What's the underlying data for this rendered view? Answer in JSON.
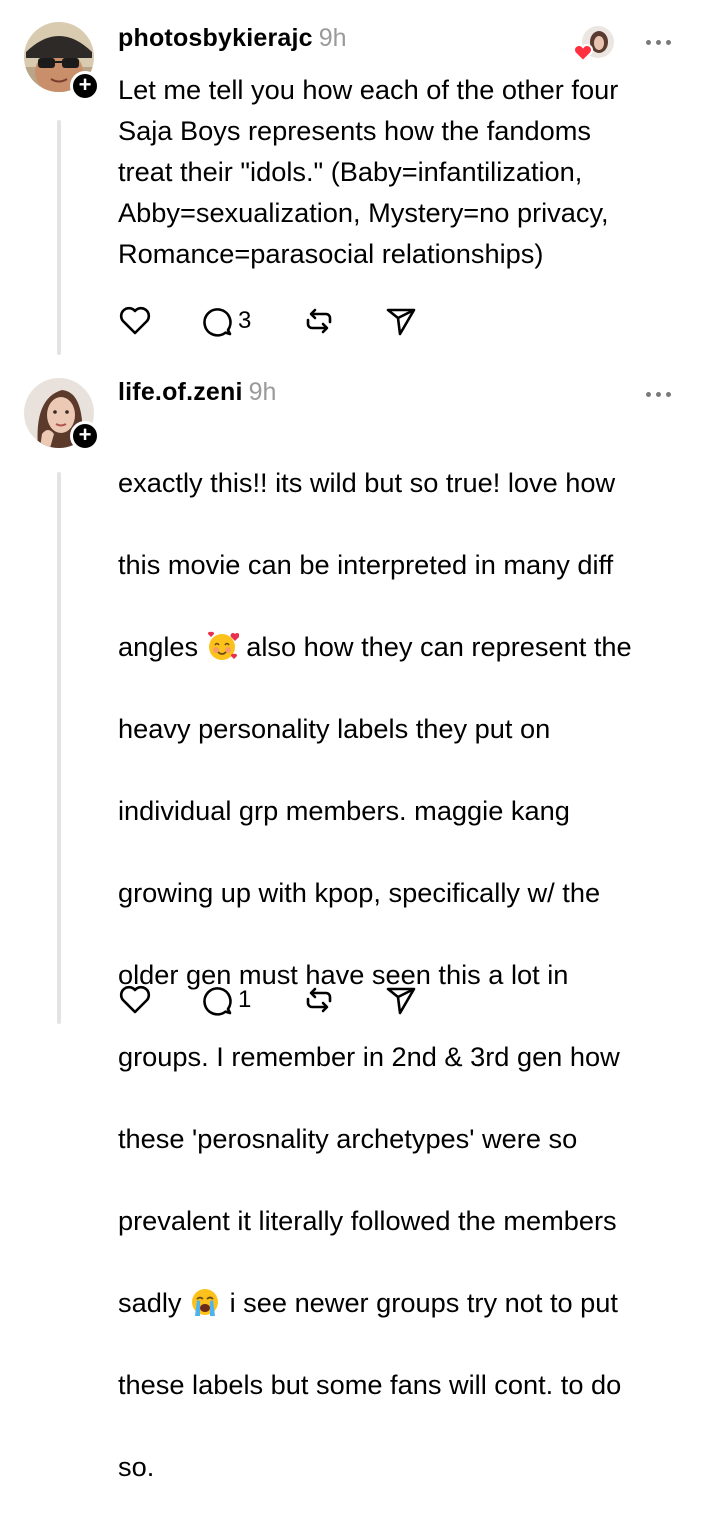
{
  "posts": [
    {
      "username": "photosbykierajc",
      "time": "9h",
      "text": "Let me tell you how each of the other four\nSaja Boys represents how the fandoms\ntreat their \"idols.\" (Baby=infantilization,\nAbby=sexualization, Mystery=no privacy,\nRomance=parasocial relationships)",
      "reply_count": "3"
    },
    {
      "username": "life.of.zeni",
      "time": "9h",
      "text_lines": {
        "l1": "exactly this!! its wild but so true! love how",
        "l2": "this movie can be interpreted in many diff",
        "l3a": "angles",
        "l3b": " also how they can represent the",
        "l4": "heavy personality labels they put on",
        "l5": "individual grp members. maggie kang",
        "l6": "growing up with kpop, specifically w/ the",
        "l7": "older gen must have seen this a lot in",
        "l8": "groups. I remember in 2nd & 3rd gen how",
        "l9": "these 'perosnality archetypes' were so",
        "l10": "prevalent it literally followed the members",
        "l11a": "sadly",
        "l11b": " i see newer groups try not to put",
        "l12": "these labels but some fans will cont. to do",
        "l13": "so."
      },
      "reply_count": "1"
    }
  ],
  "icons": {
    "like": "heart-icon",
    "reply": "comment-icon",
    "repost": "repost-icon",
    "share": "send-icon",
    "more": "more-horizontal-icon",
    "follow": "plus-icon",
    "emoji_1": "smiling-face-with-hearts-emoji",
    "emoji_2": "loudly-crying-face-emoji"
  },
  "colors": {
    "text": "#000000",
    "muted": "#9a9a9a",
    "thread_line": "#e3e3e3",
    "liked_heart": "#ff3040"
  }
}
